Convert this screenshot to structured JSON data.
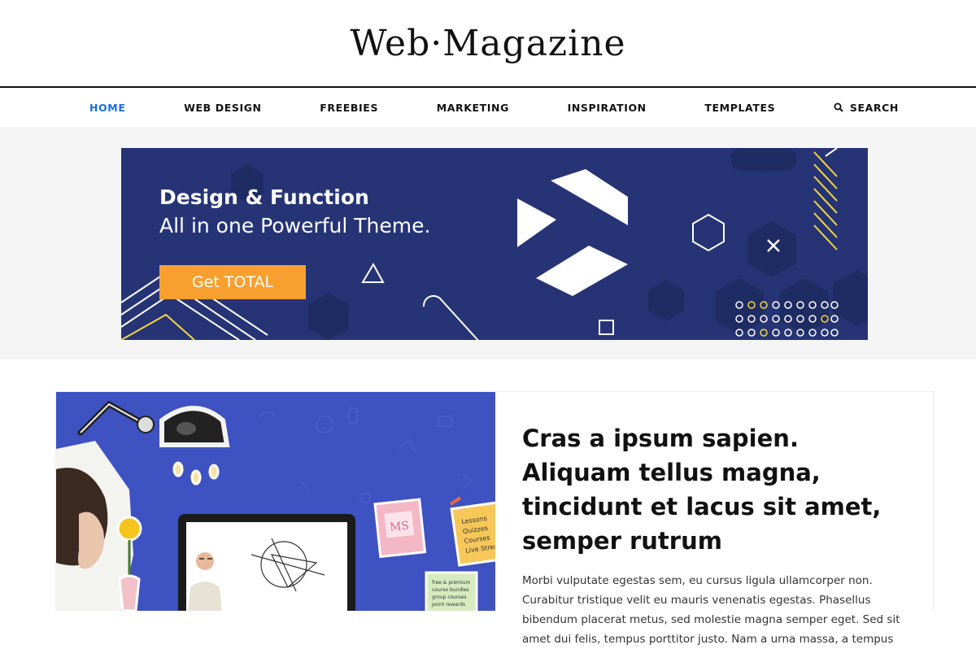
{
  "site": {
    "title": "Web·Magazine"
  },
  "nav": {
    "items": [
      "HOME",
      "WEB DESIGN",
      "FREEBIES",
      "MARKETING",
      "INSPIRATION",
      "TEMPLATES"
    ],
    "search_label": "SEARCH",
    "active_color": "#1a6fe0"
  },
  "ad": {
    "headline": "Design & Function",
    "subheadline": "All in one Powerful Theme.",
    "cta": "Get TOTAL",
    "bg_color": "#263475",
    "cta_color": "#f7a030"
  },
  "post": {
    "title": "Cras a ipsum sapien. Aliquam tellus magna, tincidunt et lacus sit amet, semper rutrum",
    "excerpt": "Morbi vulputate egestas sem, eu cursus ligula ullamcorper non. Curabitur tristique velit eu mauris venenatis egestas. Phasellus bibendum placerat metus, sed molestie magna semper eget. Sed sit amet dui felis, tempus porttitor justo. Nam a urna massa, a tempus",
    "image": {
      "sticky_note": "MS",
      "note_lines": [
        "Lessons",
        "Quizzes",
        "Courses",
        "Live Streams"
      ],
      "list_lines": [
        "free & premium",
        "course bundles",
        "group courses",
        "point rewards"
      ]
    }
  }
}
